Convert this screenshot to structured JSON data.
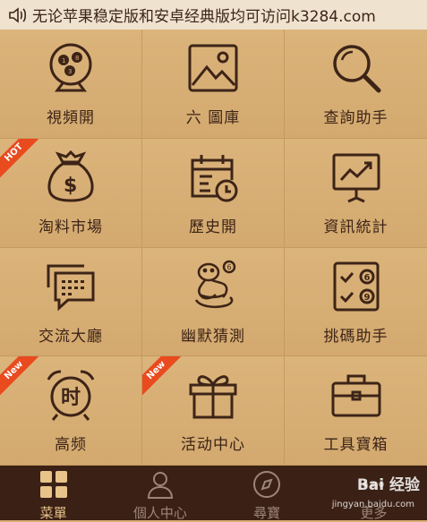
{
  "notice": {
    "text": "无论苹果稳定版和安卓经典版均可访问k3284.com",
    "icon": "speaker-icon"
  },
  "colors": {
    "background": "#d6ad73",
    "icon": "#3d2417",
    "tabbar": "#3b2115",
    "accent": "#e8c48b",
    "ribbon": "#e94a1e"
  },
  "grid": {
    "items": [
      {
        "label": "視頻開",
        "icon": "lottery-balls-icon"
      },
      {
        "label": "六 圖庫",
        "icon": "image-gallery-icon"
      },
      {
        "label": "查詢助手",
        "icon": "magnifier-icon"
      },
      {
        "label": "淘料市場",
        "icon": "money-bag-icon",
        "badge": "HOT"
      },
      {
        "label": "歷史開",
        "icon": "calendar-clock-icon"
      },
      {
        "label": "資訊統計",
        "icon": "chart-board-icon"
      },
      {
        "label": "交流大廳",
        "icon": "chat-bubbles-icon"
      },
      {
        "label": "幽默猜測",
        "icon": "snake-ball-icon"
      },
      {
        "label": "挑碼助手",
        "icon": "checklist-icon"
      },
      {
        "label": "高频",
        "icon": "alarm-clock-icon",
        "badge": "New",
        "glyph": "时"
      },
      {
        "label": "活动中心",
        "icon": "gift-box-icon",
        "badge": "New"
      },
      {
        "label": "工具寶箱",
        "icon": "toolbox-icon"
      }
    ]
  },
  "tabs": [
    {
      "label": "菜單",
      "icon": "menu-grid-icon",
      "active": true
    },
    {
      "label": "個人中心",
      "icon": "user-icon",
      "active": false
    },
    {
      "label": "尋寶",
      "icon": "compass-icon",
      "active": false
    },
    {
      "label": "更多",
      "icon": "more-icon",
      "active": false
    }
  ],
  "watermark": {
    "brand": "Bai 经验",
    "url": "jingyan.baidu.com"
  }
}
